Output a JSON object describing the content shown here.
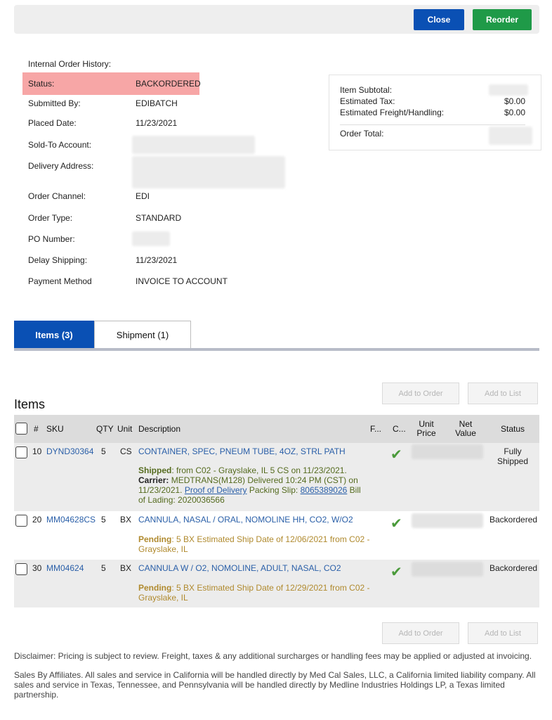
{
  "toolbar": {
    "close_label": "Close",
    "reorder_label": "Reorder"
  },
  "details": {
    "title": "Internal Order History:",
    "rows": [
      {
        "label": "Status:",
        "value": "BACKORDERED"
      },
      {
        "label": "Submitted By:",
        "value": "EDIBATCH"
      },
      {
        "label": "Placed Date:",
        "value": "11/23/2021"
      },
      {
        "label": "Sold-To Account:",
        "value": ""
      },
      {
        "label": "Delivery Address:",
        "value": ""
      },
      {
        "label": "Order Channel:",
        "value": "EDI"
      },
      {
        "label": "Order Type:",
        "value": "STANDARD"
      },
      {
        "label": "PO Number:",
        "value": ""
      },
      {
        "label": "Delay Shipping:",
        "value": "11/23/2021"
      },
      {
        "label": "Payment Method",
        "value": "INVOICE TO ACCOUNT"
      }
    ]
  },
  "summary": {
    "item_subtotal_label": "Item Subtotal:",
    "estimated_tax_label": "Estimated Tax:",
    "estimated_tax_value": "$0.00",
    "freight_label": "Estimated Freight/Handling:",
    "freight_value": "$0.00",
    "order_total_label": "Order Total:"
  },
  "tabs": [
    {
      "label": "Items (3)",
      "active": true
    },
    {
      "label": "Shipment (1)",
      "active": false
    }
  ],
  "actions": {
    "add_to_order": "Add to Order",
    "add_to_list": "Add to List"
  },
  "items_heading": "Items",
  "table": {
    "headers": {
      "num": "#",
      "sku": "SKU",
      "qty": "QTY",
      "unit": "Unit",
      "description": "Description",
      "f": "F...",
      "c": "C...",
      "unit_price": "Unit Price",
      "net_value": "Net Value",
      "status": "Status"
    },
    "rows": [
      {
        "num": "10",
        "sku": "DYND30364",
        "qty": "5",
        "unit": "CS",
        "description": "CONTAINER, SPEC, PNEUM TUBE, 4OZ, STRL PATH",
        "status": "Fully Shipped",
        "note_label": "Shipped",
        "note_text": ": from C02 - Grayslake, IL 5 CS on 11/23/2021.",
        "carrier_label": "Carrier:",
        "carrier_text": " MEDTRANS(M128) Delivered 10:24 PM (CST) on 11/23/2021. ",
        "pod_link": " Proof of Delivery",
        "packing_label": " Packing Slip: ",
        "packing_link": "8065389026",
        "bol_text": " Bill of Lading: 2020036566"
      },
      {
        "num": "20",
        "sku": "MM04628CS",
        "qty": "5",
        "unit": "BX",
        "description": "CANNULA, NASAL / ORAL, NOMOLINE HH, CO2, W/O2",
        "status": "Backordered",
        "note_label": "Pending",
        "note_text": ": 5 BX Estimated Ship Date of 12/06/2021 from C02 - Grayslake, IL"
      },
      {
        "num": "30",
        "sku": "MM04624",
        "qty": "5",
        "unit": "BX",
        "description": "CANNULA W / O2, NOMOLINE, ADULT, NASAL, CO2",
        "status": "Backordered",
        "note_label": "Pending",
        "note_text": ": 5 BX Estimated Ship Date of 12/29/2021 from C02 - Grayslake, IL"
      }
    ]
  },
  "disclaimer": "Disclaimer: Pricing is subject to review. Freight, taxes & any additional surcharges or handling fees may be applied or adjusted at invoicing.",
  "affiliates": "Sales By Affiliates. All sales and service in California will be handled directly by Med Cal Sales, LLC, a California limited liability company. All sales and service in Texas, Tennessee, and Pennsylvania will be handled directly by Medline Industries Holdings LP, a Texas limited partnership.",
  "colors": {
    "primary": "#0a50b4",
    "success": "#1f9a48",
    "status_highlight": "#f7a6a6",
    "link": "#2a5fa8"
  }
}
